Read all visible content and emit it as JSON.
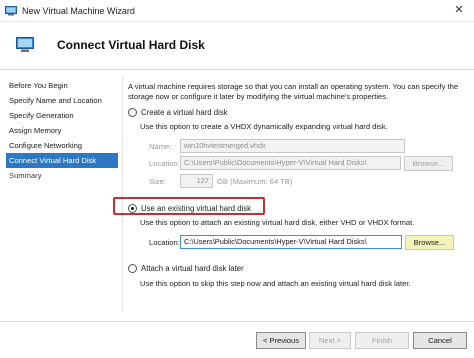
{
  "window": {
    "title": "New Virtual Machine Wizard",
    "close_glyph": "✕",
    "app_icon": "virtual-machine-icon"
  },
  "header": {
    "title": "Connect Virtual Hard Disk",
    "icon": "virtual-machine-icon"
  },
  "sidebar": {
    "items": [
      {
        "label": "Before You Begin",
        "state": "normal"
      },
      {
        "label": "Specify Name and Location",
        "state": "normal"
      },
      {
        "label": "Specify Generation",
        "state": "normal"
      },
      {
        "label": "Assign Memory",
        "state": "normal"
      },
      {
        "label": "Configure Networking",
        "state": "normal"
      },
      {
        "label": "Connect Virtual Hard Disk",
        "state": "active"
      },
      {
        "label": "Summary",
        "state": "normal"
      }
    ]
  },
  "content": {
    "intro_line1": "A virtual machine requires storage so that you can install an operating system. You can specify the",
    "intro_line2": "storage now or configure it later by modifying the virtual machine's properties.",
    "create": {
      "label": "Create a virtual hard disk",
      "checked": false,
      "description": "Use this option to create a VHDX dynamically expanding virtual hard disk.",
      "name_label": "Name:",
      "name_value": "win10hvtestmerged.vhdx",
      "location_label": "Location:",
      "location_value": "C:\\Users\\Public\\Documents\\Hyper-V\\Virtual Hard Disks\\",
      "browse_label": "Browse...",
      "size_label": "Size:",
      "size_value": "127",
      "size_unit": "GB (Maximum: 64 TB)"
    },
    "existing": {
      "label": "Use an existing virtual hard disk",
      "checked": true,
      "description": "Use this option to attach an existing virtual hard disk, either VHD or VHDX format.",
      "location_label": "Location:",
      "location_value": "C:\\Users\\Public\\Documents\\Hyper-V\\Virtual Hard Disks\\",
      "browse_label": "Browse..."
    },
    "later": {
      "label": "Attach a virtual hard disk later",
      "checked": false,
      "description": "Use this option to skip this step now and attach an existing virtual hard disk later."
    }
  },
  "footer": {
    "previous_label": "< Previous",
    "next_label": "Next >",
    "finish_label": "Finish",
    "cancel_label": "Cancel"
  },
  "colors": {
    "active_sidebar": "#2b79c4",
    "highlight_box": "#d02a2a",
    "browse_highlight": "#f3f3b9"
  }
}
